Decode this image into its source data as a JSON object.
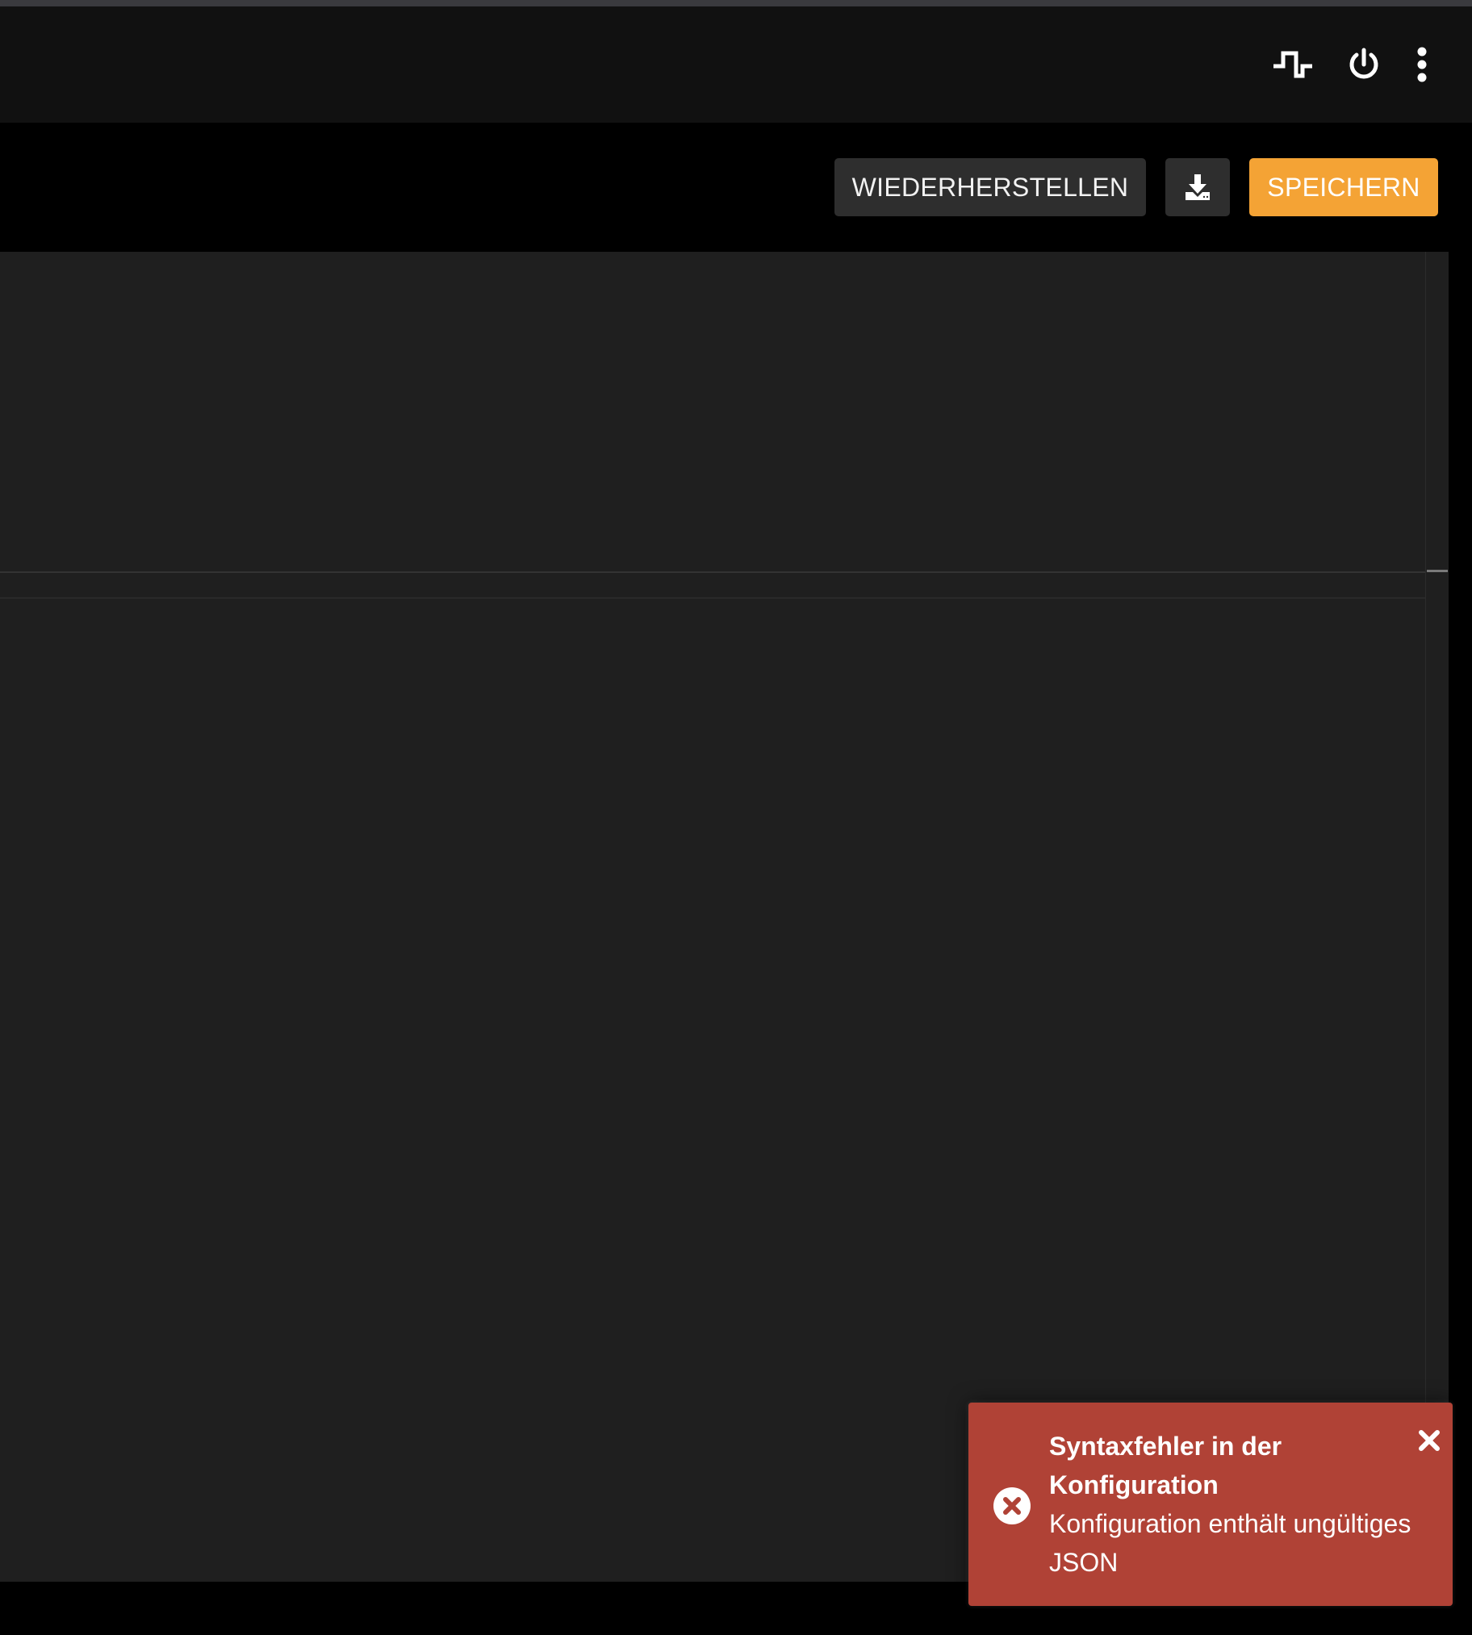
{
  "appbar": {
    "icons": [
      "pulse-icon",
      "power-icon",
      "more-vert-icon"
    ]
  },
  "toolbar": {
    "restore_label": "WIEDERHERSTELLEN",
    "download_icon": "download-icon",
    "save_label": "SPEICHERN"
  },
  "toast": {
    "title": "Syntaxfehler in der Konfiguration",
    "message": "Konfiguration enthält ungültiges JSON",
    "icon": "error-circle-icon",
    "close_icon": "close-icon"
  },
  "colors": {
    "save_accent": "#f4a335",
    "toast_bg": "#b04236",
    "editor_bg": "#1f1f1f",
    "appbar_bg": "#111111"
  }
}
